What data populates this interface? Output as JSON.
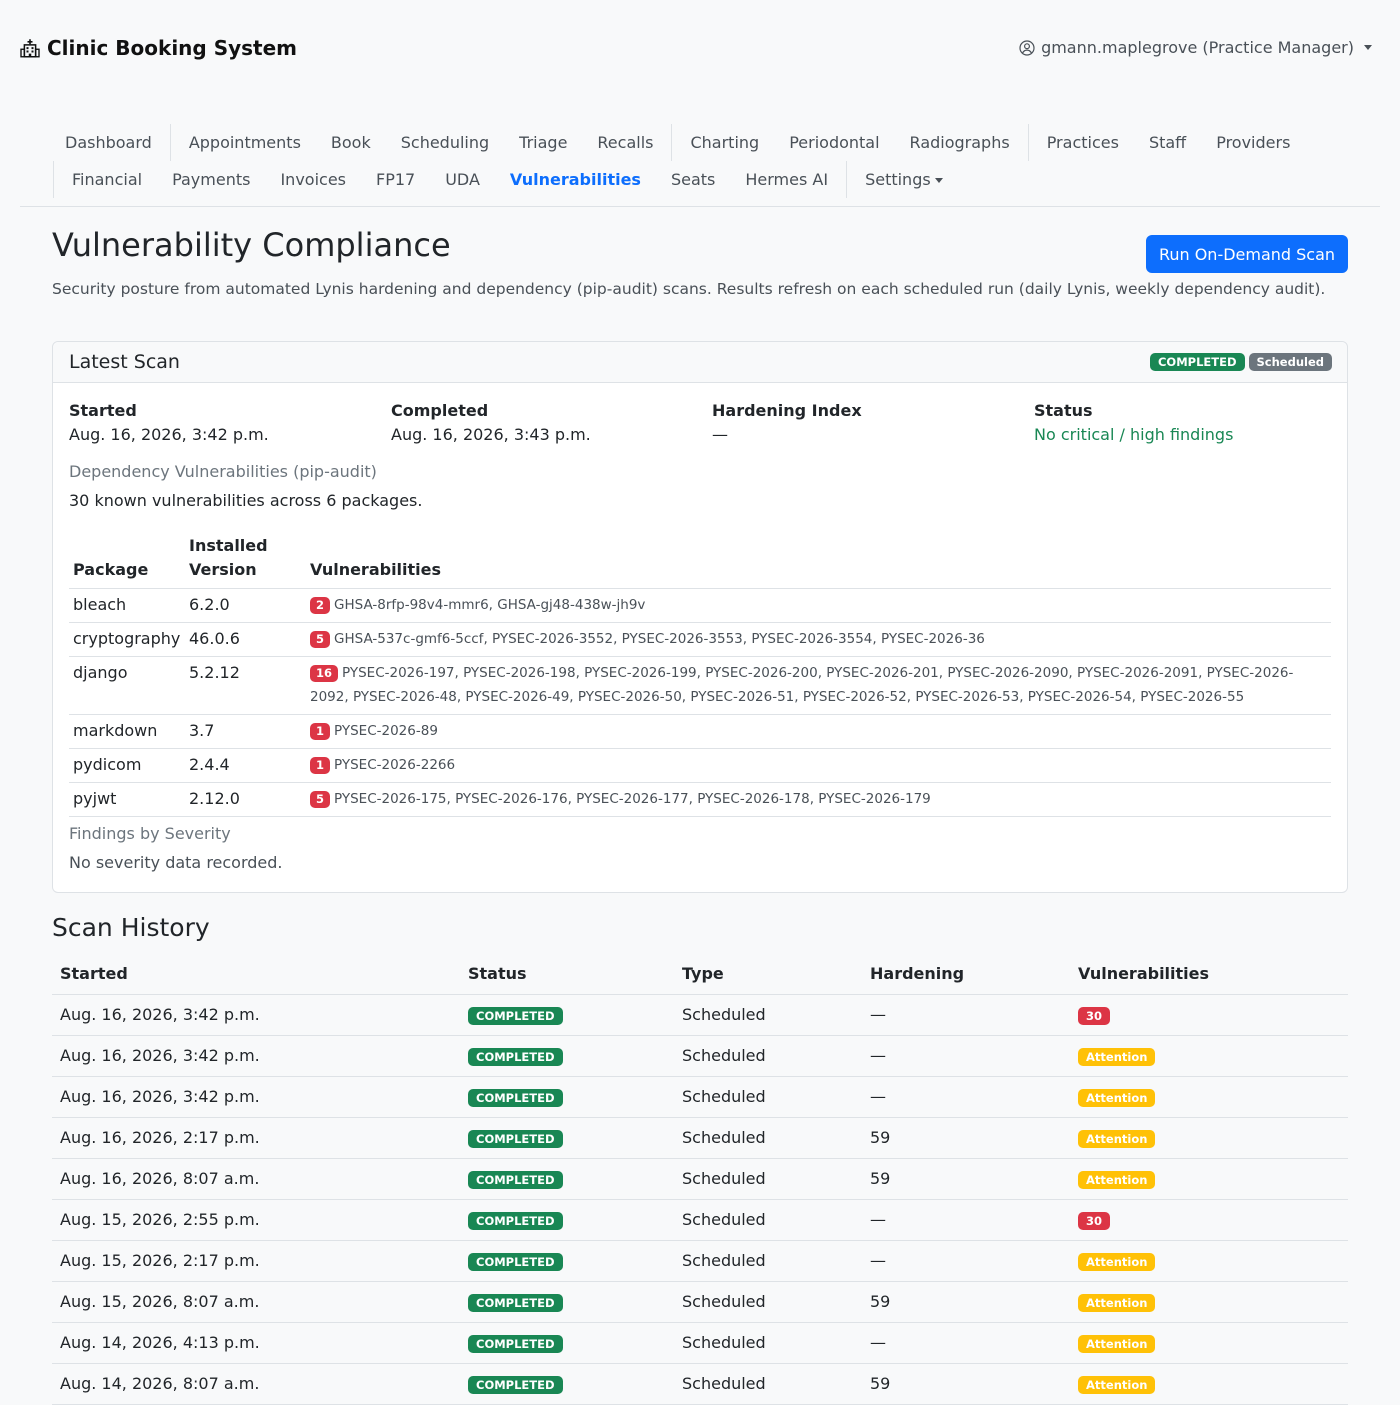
{
  "app": {
    "title": "Clinic Booking System",
    "user": "gmann.maplegrove (Practice Manager)"
  },
  "nav": {
    "row1": [
      "Dashboard",
      "Appointments",
      "Book",
      "Scheduling",
      "Triage",
      "Recalls",
      "Charting",
      "Periodontal",
      "Radiographs",
      "Practices",
      "Staff",
      "Providers"
    ],
    "row2": [
      "Financial",
      "Payments",
      "Invoices",
      "FP17",
      "UDA",
      "Vulnerabilities",
      "Seats",
      "Hermes AI",
      "Settings"
    ],
    "active": "Vulnerabilities"
  },
  "page": {
    "title": "Vulnerability Compliance",
    "run_button": "Run On-Demand Scan",
    "intro": "Security posture from automated Lynis hardening and dependency (pip-audit) scans. Results refresh on each scheduled run (daily Lynis, weekly dependency audit)."
  },
  "latest": {
    "header": "Latest Scan",
    "status_badge": "COMPLETED",
    "type_badge": "Scheduled",
    "started_label": "Started",
    "started": "Aug. 16, 2026, 3:42 p.m.",
    "completed_label": "Completed",
    "completed": "Aug. 16, 2026, 3:43 p.m.",
    "hardening_label": "Hardening Index",
    "hardening": "—",
    "status_label": "Status",
    "status": "No critical / high findings",
    "dep_title": "Dependency Vulnerabilities (pip-audit)",
    "dep_summary": "30 known vulnerabilities across 6 packages.",
    "columns": {
      "package": "Package",
      "installed": "Installed Version",
      "vulns": "Vulnerabilities"
    },
    "packages": [
      {
        "name": "bleach",
        "version": "6.2.0",
        "count": "2",
        "ids": "GHSA-8rfp-98v4-mmr6, GHSA-gj48-438w-jh9v"
      },
      {
        "name": "cryptography",
        "version": "46.0.6",
        "count": "5",
        "ids": "GHSA-537c-gmf6-5ccf, PYSEC-2026-3552, PYSEC-2026-3553, PYSEC-2026-3554, PYSEC-2026-36"
      },
      {
        "name": "django",
        "version": "5.2.12",
        "count": "16",
        "ids": "PYSEC-2026-197, PYSEC-2026-198, PYSEC-2026-199, PYSEC-2026-200, PYSEC-2026-201, PYSEC-2026-2090, PYSEC-2026-2091, PYSEC-2026-2092, PYSEC-2026-48, PYSEC-2026-49, PYSEC-2026-50, PYSEC-2026-51, PYSEC-2026-52, PYSEC-2026-53, PYSEC-2026-54, PYSEC-2026-55"
      },
      {
        "name": "markdown",
        "version": "3.7",
        "count": "1",
        "ids": "PYSEC-2026-89"
      },
      {
        "name": "pydicom",
        "version": "2.4.4",
        "count": "1",
        "ids": "PYSEC-2026-2266"
      },
      {
        "name": "pyjwt",
        "version": "2.12.0",
        "count": "5",
        "ids": "PYSEC-2026-175, PYSEC-2026-176, PYSEC-2026-177, PYSEC-2026-178, PYSEC-2026-179"
      }
    ],
    "severity_title": "Findings by Severity",
    "severity_note": "No severity data recorded."
  },
  "history": {
    "title": "Scan History",
    "columns": [
      "Started",
      "Status",
      "Type",
      "Hardening",
      "Vulnerabilities"
    ],
    "rows": [
      {
        "started": "Aug. 16, 2026, 3:42 p.m.",
        "status": "COMPLETED",
        "type": "Scheduled",
        "hardening": "—",
        "vuln": "30",
        "vuln_kind": "danger"
      },
      {
        "started": "Aug. 16, 2026, 3:42 p.m.",
        "status": "COMPLETED",
        "type": "Scheduled",
        "hardening": "—",
        "vuln": "Attention",
        "vuln_kind": "warning"
      },
      {
        "started": "Aug. 16, 2026, 3:42 p.m.",
        "status": "COMPLETED",
        "type": "Scheduled",
        "hardening": "—",
        "vuln": "Attention",
        "vuln_kind": "warning"
      },
      {
        "started": "Aug. 16, 2026, 2:17 p.m.",
        "status": "COMPLETED",
        "type": "Scheduled",
        "hardening": "59",
        "vuln": "Attention",
        "vuln_kind": "warning"
      },
      {
        "started": "Aug. 16, 2026, 8:07 a.m.",
        "status": "COMPLETED",
        "type": "Scheduled",
        "hardening": "59",
        "vuln": "Attention",
        "vuln_kind": "warning"
      },
      {
        "started": "Aug. 15, 2026, 2:55 p.m.",
        "status": "COMPLETED",
        "type": "Scheduled",
        "hardening": "—",
        "vuln": "30",
        "vuln_kind": "danger"
      },
      {
        "started": "Aug. 15, 2026, 2:17 p.m.",
        "status": "COMPLETED",
        "type": "Scheduled",
        "hardening": "—",
        "vuln": "Attention",
        "vuln_kind": "warning"
      },
      {
        "started": "Aug. 15, 2026, 8:07 a.m.",
        "status": "COMPLETED",
        "type": "Scheduled",
        "hardening": "59",
        "vuln": "Attention",
        "vuln_kind": "warning"
      },
      {
        "started": "Aug. 14, 2026, 4:13 p.m.",
        "status": "COMPLETED",
        "type": "Scheduled",
        "hardening": "—",
        "vuln": "Attention",
        "vuln_kind": "warning"
      },
      {
        "started": "Aug. 14, 2026, 8:07 a.m.",
        "status": "COMPLETED",
        "type": "Scheduled",
        "hardening": "59",
        "vuln": "Attention",
        "vuln_kind": "warning"
      }
    ]
  },
  "colors": {
    "primary": "#0d6efd",
    "success": "#198754",
    "danger": "#dc3545",
    "warning": "#ffc107",
    "secondary": "#6c757d"
  }
}
